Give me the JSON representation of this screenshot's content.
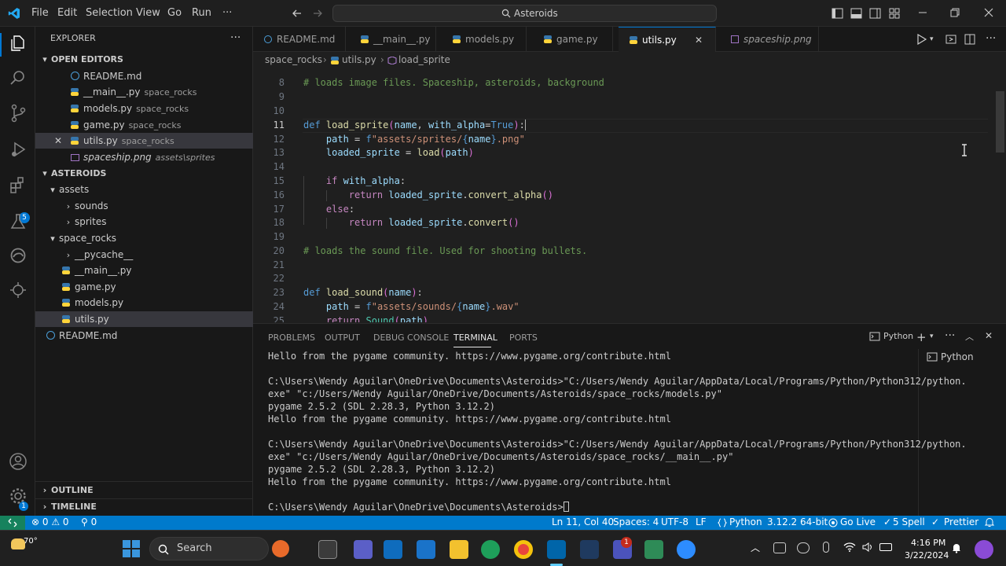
{
  "titlebar": {
    "menu": [
      "File",
      "Edit",
      "Selection",
      "View",
      "Go",
      "Run",
      "···"
    ],
    "search": "Asteroids"
  },
  "sidebar": {
    "title": "EXPLORER",
    "open_editors_label": "OPEN EDITORS",
    "open_editors": [
      {
        "name": "README.md",
        "path": ""
      },
      {
        "name": "__main__.py",
        "path": "space_rocks"
      },
      {
        "name": "models.py",
        "path": "space_rocks"
      },
      {
        "name": "game.py",
        "path": "space_rocks"
      },
      {
        "name": "utils.py",
        "path": "space_rocks"
      },
      {
        "name": "spaceship.png",
        "path": "assets\\sprites"
      }
    ],
    "workspace_label": "ASTEROIDS",
    "tree": {
      "assets": "assets",
      "sounds": "sounds",
      "sprites": "sprites",
      "space_rocks": "space_rocks",
      "pycache": "__pycache__",
      "main": "__main__.py",
      "game": "game.py",
      "models": "models.py",
      "utils": "utils.py",
      "readme": "README.md"
    },
    "outline_label": "OUTLINE",
    "timeline_label": "TIMELINE"
  },
  "tabs": [
    "README.md",
    "__main__.py",
    "models.py",
    "game.py",
    "utils.py",
    "spaceship.png"
  ],
  "breadcrumb": [
    "space_rocks",
    "utils.py",
    "load_sprite"
  ],
  "editor": {
    "line_numbers": [
      "8",
      "9",
      "10",
      "11",
      "12",
      "13",
      "14",
      "15",
      "16",
      "17",
      "18",
      "19",
      "20",
      "21",
      "22",
      "23",
      "24",
      "25"
    ],
    "comment1": "# loads image files. Spaceship, asteroids, background",
    "comment2": "# loads the sound file. Used for shooting bullets."
  },
  "panel": {
    "tabs": [
      "PROBLEMS",
      "OUTPUT",
      "DEBUG CONSOLE",
      "TERMINAL",
      "PORTS"
    ],
    "shell": "Python",
    "terminal_list_item": "Python",
    "lines": [
      "Hello from the pygame community. https://www.pygame.org/contribute.html",
      "",
      "C:\\Users\\Wendy Aguilar\\OneDrive\\Documents\\Asteroids>\"C:/Users/Wendy Aguilar/AppData/Local/Programs/Python/Python312/python.",
      "exe\" \"c:/Users/Wendy Aguilar/OneDrive/Documents/Asteroids/space_rocks/models.py\"",
      "pygame 2.5.2 (SDL 2.28.3, Python 3.12.2)",
      "Hello from the pygame community. https://www.pygame.org/contribute.html",
      "",
      "C:\\Users\\Wendy Aguilar\\OneDrive\\Documents\\Asteroids>\"C:/Users/Wendy Aguilar/AppData/Local/Programs/Python/Python312/python.",
      "exe\" \"c:/Users/Wendy Aguilar/OneDrive/Documents/Asteroids/space_rocks/__main__.py\"",
      "pygame 2.5.2 (SDL 2.28.3, Python 3.12.2)",
      "Hello from the pygame community. https://www.pygame.org/contribute.html",
      "",
      "C:\\Users\\Wendy Aguilar\\OneDrive\\Documents\\Asteroids>"
    ]
  },
  "statusbar": {
    "errors": "⊗ 0 ⚠ 0",
    "ports": "⚲ 0",
    "position": "Ln 11, Col 40",
    "spaces": "Spaces: 4",
    "encoding": "UTF-8",
    "eol": "LF",
    "language": "Python",
    "interpreter": "3.12.2 64-bit",
    "golive": "Go Live",
    "spell": "5 Spell",
    "prettier": "Prettier"
  },
  "taskbar": {
    "weather": "70°",
    "search": "Search",
    "time": "4:16 PM",
    "date": "3/22/2024",
    "notification_count": "1"
  },
  "colors": {
    "accent": "#007acc",
    "editor_bg": "#1f1f1f",
    "sidebar_bg": "#181818"
  }
}
